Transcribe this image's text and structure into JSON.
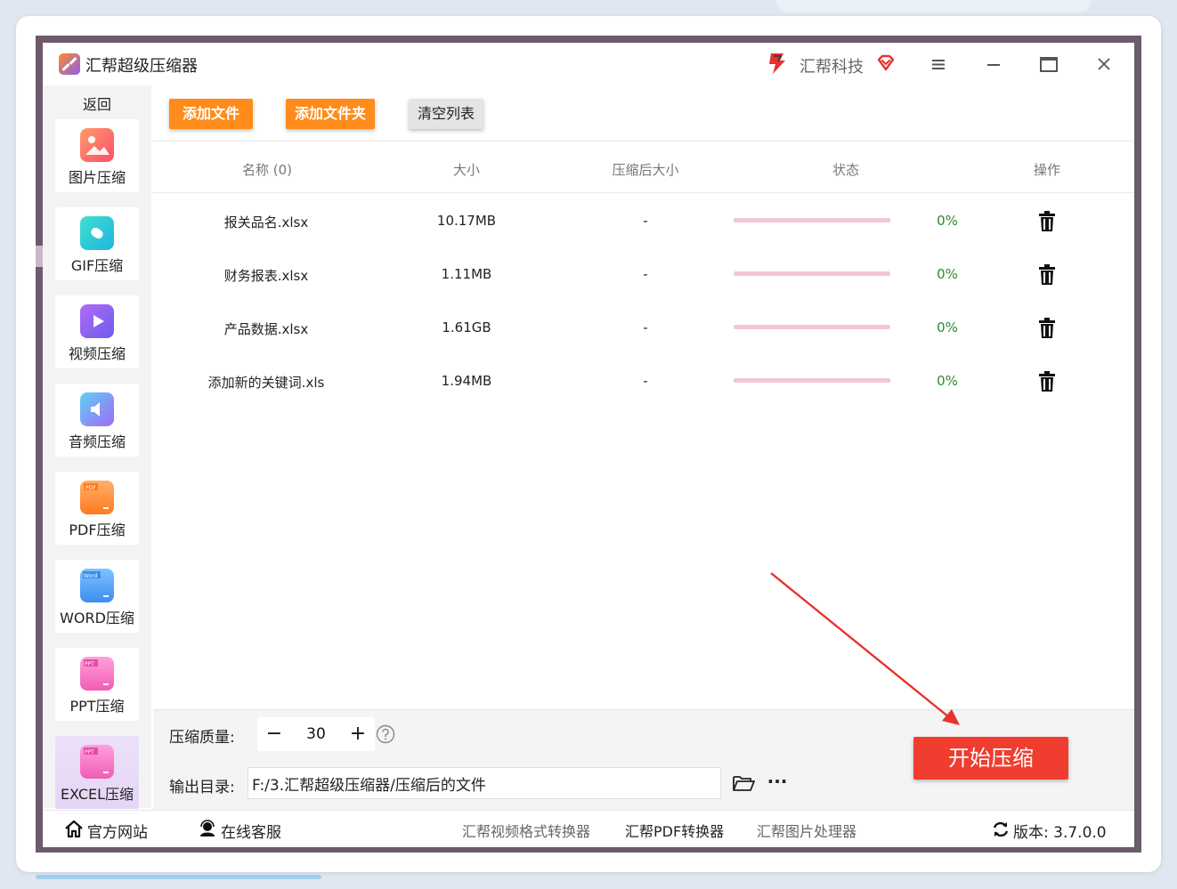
{
  "app": {
    "title": "汇帮超级压缩器",
    "brand_name": "汇帮科技"
  },
  "sidebar": {
    "back_label": "返回",
    "items": [
      {
        "label": "图片压缩",
        "icon": "image-icon",
        "color": "#ff6a4d"
      },
      {
        "label": "GIF压缩",
        "icon": "gif-icon",
        "color": "#2fd0d6"
      },
      {
        "label": "视频压缩",
        "icon": "video-play-icon",
        "color": "#8c5cf0"
      },
      {
        "label": "音频压缩",
        "icon": "audio-icon",
        "color": "#4db2f5"
      },
      {
        "label": "PDF压缩",
        "icon": "pdf-file-icon",
        "color": "#ff8a1e"
      },
      {
        "label": "WORD压缩",
        "icon": "word-file-icon",
        "color": "#3c9bf0"
      },
      {
        "label": "PPT压缩",
        "icon": "ppt-file-icon",
        "color": "#f25cb5"
      },
      {
        "label": "EXCEL压缩",
        "icon": "excel-file-icon",
        "color": "#f25cb5"
      }
    ],
    "active_index": 7
  },
  "toolbar": {
    "add_file_label": "添加文件",
    "add_folder_label": "添加文件夹",
    "clear_list_label": "清空列表"
  },
  "table": {
    "headers": {
      "name": "名称 (0)",
      "size": "大小",
      "compressed_size": "压缩后大小",
      "status": "状态",
      "action": "操作"
    },
    "rows": [
      {
        "name": "报关品名.xlsx",
        "size": "10.17MB",
        "compressed": "-",
        "progress": 0,
        "percent": "0%"
      },
      {
        "name": "财务报表.xlsx",
        "size": "1.11MB",
        "compressed": "-",
        "progress": 0,
        "percent": "0%"
      },
      {
        "name": "产品数据.xlsx",
        "size": "1.61GB",
        "compressed": "-",
        "progress": 0,
        "percent": "0%"
      },
      {
        "name": "添加新的关键词.xls",
        "size": "1.94MB",
        "compressed": "-",
        "progress": 0,
        "percent": "0%"
      }
    ]
  },
  "settings": {
    "quality_label": "压缩质量:",
    "quality_value": "30",
    "minus": "−",
    "plus": "+",
    "output_label": "输出目录:",
    "output_path": "F:/3.汇帮超级压缩器/压缩后的文件",
    "more": "···",
    "start_label": "开始压缩"
  },
  "statusbar": {
    "website": "官方网站",
    "support": "在线客服",
    "link_video": "汇帮视频格式转换器",
    "link_pdf": "汇帮PDF转换器",
    "link_image": "汇帮图片处理器",
    "version": "版本: 3.7.0.0"
  },
  "colors": {
    "accent_orange": "#ff8c1a",
    "start_red": "#f03d2f",
    "percent_green": "#2a8a2a",
    "progress_pink": "#f4c6d1",
    "arrow_red": "#e8322c"
  }
}
